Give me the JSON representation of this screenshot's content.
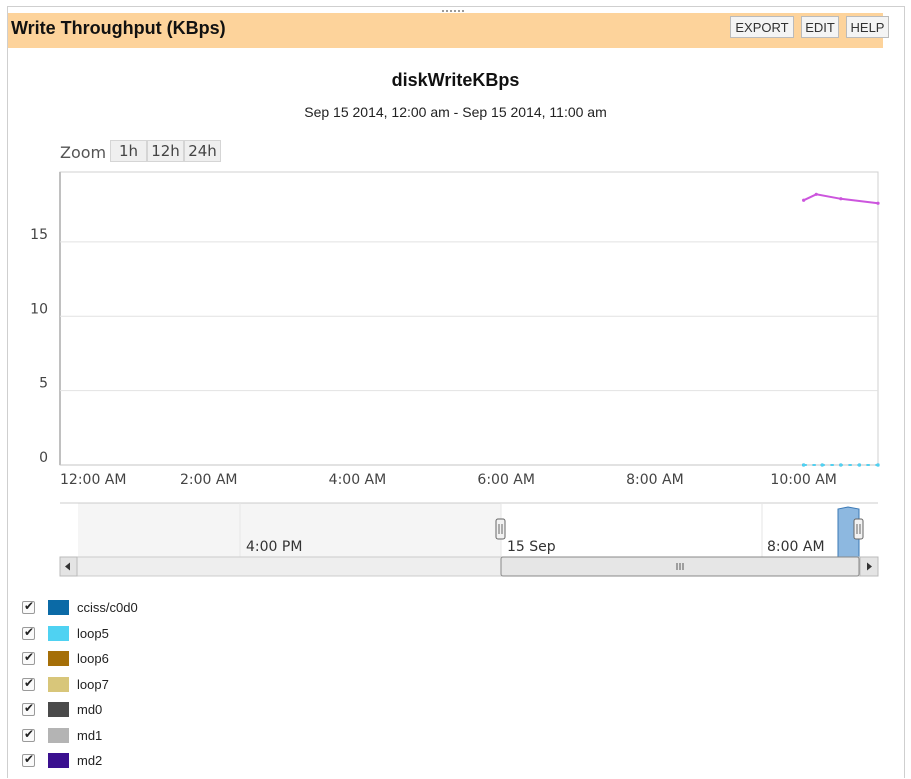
{
  "header": {
    "title": "Write Throughput (KBps)",
    "buttons": [
      "EXPORT",
      "EDIT",
      "HELP"
    ]
  },
  "zoom": {
    "label": "Zoom",
    "buttons": [
      "1h",
      "12h",
      "24h"
    ]
  },
  "navigator": {
    "labels": [
      "4:00 PM",
      "15 Sep",
      "8:00 AM"
    ],
    "scroll_left_icon": "arrow-left-icon",
    "scroll_right_icon": "arrow-right-icon",
    "scroll_grip_icon": "grip-icon"
  },
  "colors": {
    "header_bg": "#fdd39b",
    "series_line": "#cc55dd",
    "navigator_fill": "#8db8e0"
  },
  "chart_data": {
    "type": "line",
    "title": "diskWriteKBps",
    "subtitle": "Sep 15 2014, 12:00 am - Sep 15 2014, 11:00 am",
    "xlabel": "",
    "ylabel": "",
    "x_ticks": [
      "12:00 AM",
      "2:00 AM",
      "4:00 AM",
      "6:00 AM",
      "8:00 AM",
      "10:00 AM"
    ],
    "x_tick_hours": [
      0,
      2,
      4,
      6,
      8,
      10
    ],
    "x_range_hours": [
      0,
      11
    ],
    "y_ticks": [
      0,
      5,
      10,
      15
    ],
    "ylim": [
      0,
      19.7
    ],
    "grid": true,
    "series": [
      {
        "name": "cciss/c0d0",
        "color": "#0b6aa6",
        "points": [
          [
            10,
            0
          ],
          [
            10.25,
            0
          ],
          [
            10.5,
            0
          ],
          [
            10.75,
            0
          ],
          [
            11,
            0
          ]
        ]
      },
      {
        "name": "loop5",
        "color": "#4fd2f2",
        "points": [
          [
            10,
            0
          ],
          [
            10.25,
            0
          ],
          [
            10.5,
            0
          ],
          [
            10.75,
            0
          ],
          [
            11,
            0
          ]
        ]
      },
      {
        "name": "loop6",
        "color": "#a56f08",
        "points": []
      },
      {
        "name": "loop7",
        "color": "#d8c67a",
        "points": []
      },
      {
        "name": "md0",
        "color": "#4a4a4a",
        "points": []
      },
      {
        "name": "md1",
        "color": "#b4b4b4",
        "points": []
      },
      {
        "name": "md2",
        "color": "#3a108f",
        "points": [
          [
            10,
            17.8
          ],
          [
            10.17,
            18.2
          ],
          [
            10.5,
            17.9
          ],
          [
            11,
            17.6
          ]
        ]
      }
    ],
    "legend_position": "bottom-left"
  }
}
